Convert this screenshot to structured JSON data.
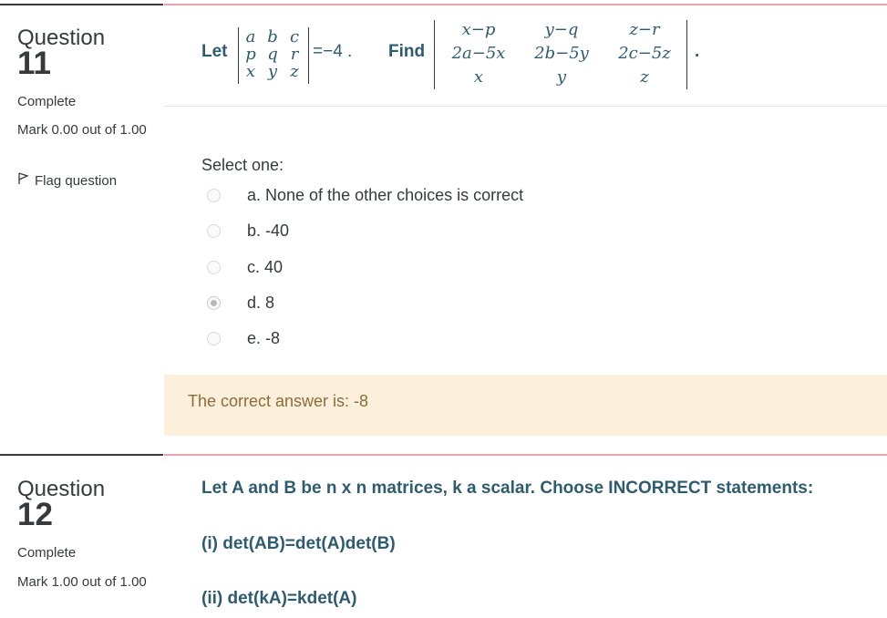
{
  "questions": [
    {
      "label": "Question",
      "number": "11",
      "state": "Complete",
      "mark": "Mark 0.00 out of 1.00",
      "flag": "Flag question",
      "text": {
        "let": "Let",
        "equals": "=−4 .",
        "find": "Find",
        "end": ".",
        "matrix1": [
          [
            "a",
            "b",
            "c"
          ],
          [
            "p",
            "q",
            "r"
          ],
          [
            "x",
            "y",
            "z"
          ]
        ],
        "matrix2": [
          [
            "x−p",
            "y−q",
            "z−r"
          ],
          [
            "2a−5x",
            "2b−5y",
            "2c−5z"
          ],
          [
            "x",
            "y",
            "z"
          ]
        ]
      },
      "select_label": "Select one:",
      "options": [
        {
          "label": "a. None of the other choices is correct",
          "checked": false
        },
        {
          "label": "b. -40",
          "checked": false
        },
        {
          "label": "c. 40",
          "checked": false
        },
        {
          "label": "d. 8",
          "checked": true
        },
        {
          "label": "e. -8",
          "checked": false
        }
      ],
      "feedback": "The correct answer is: -8"
    },
    {
      "label": "Question",
      "number": "12",
      "state": "Complete",
      "mark": "Mark 1.00 out of 1.00",
      "lines": [
        "Let A and B be n x n matrices, k a scalar. Choose INCORRECT statements:",
        "(i) det(AB)=det(A)det(B)",
        "(ii) det(kA)=kdet(A)"
      ]
    }
  ],
  "colors": {
    "question_text": "#2f5b6e",
    "feedback_bg": "#fcefdc",
    "feedback_text": "#8a6d3b",
    "divider_accent": "#e8a3ab"
  }
}
